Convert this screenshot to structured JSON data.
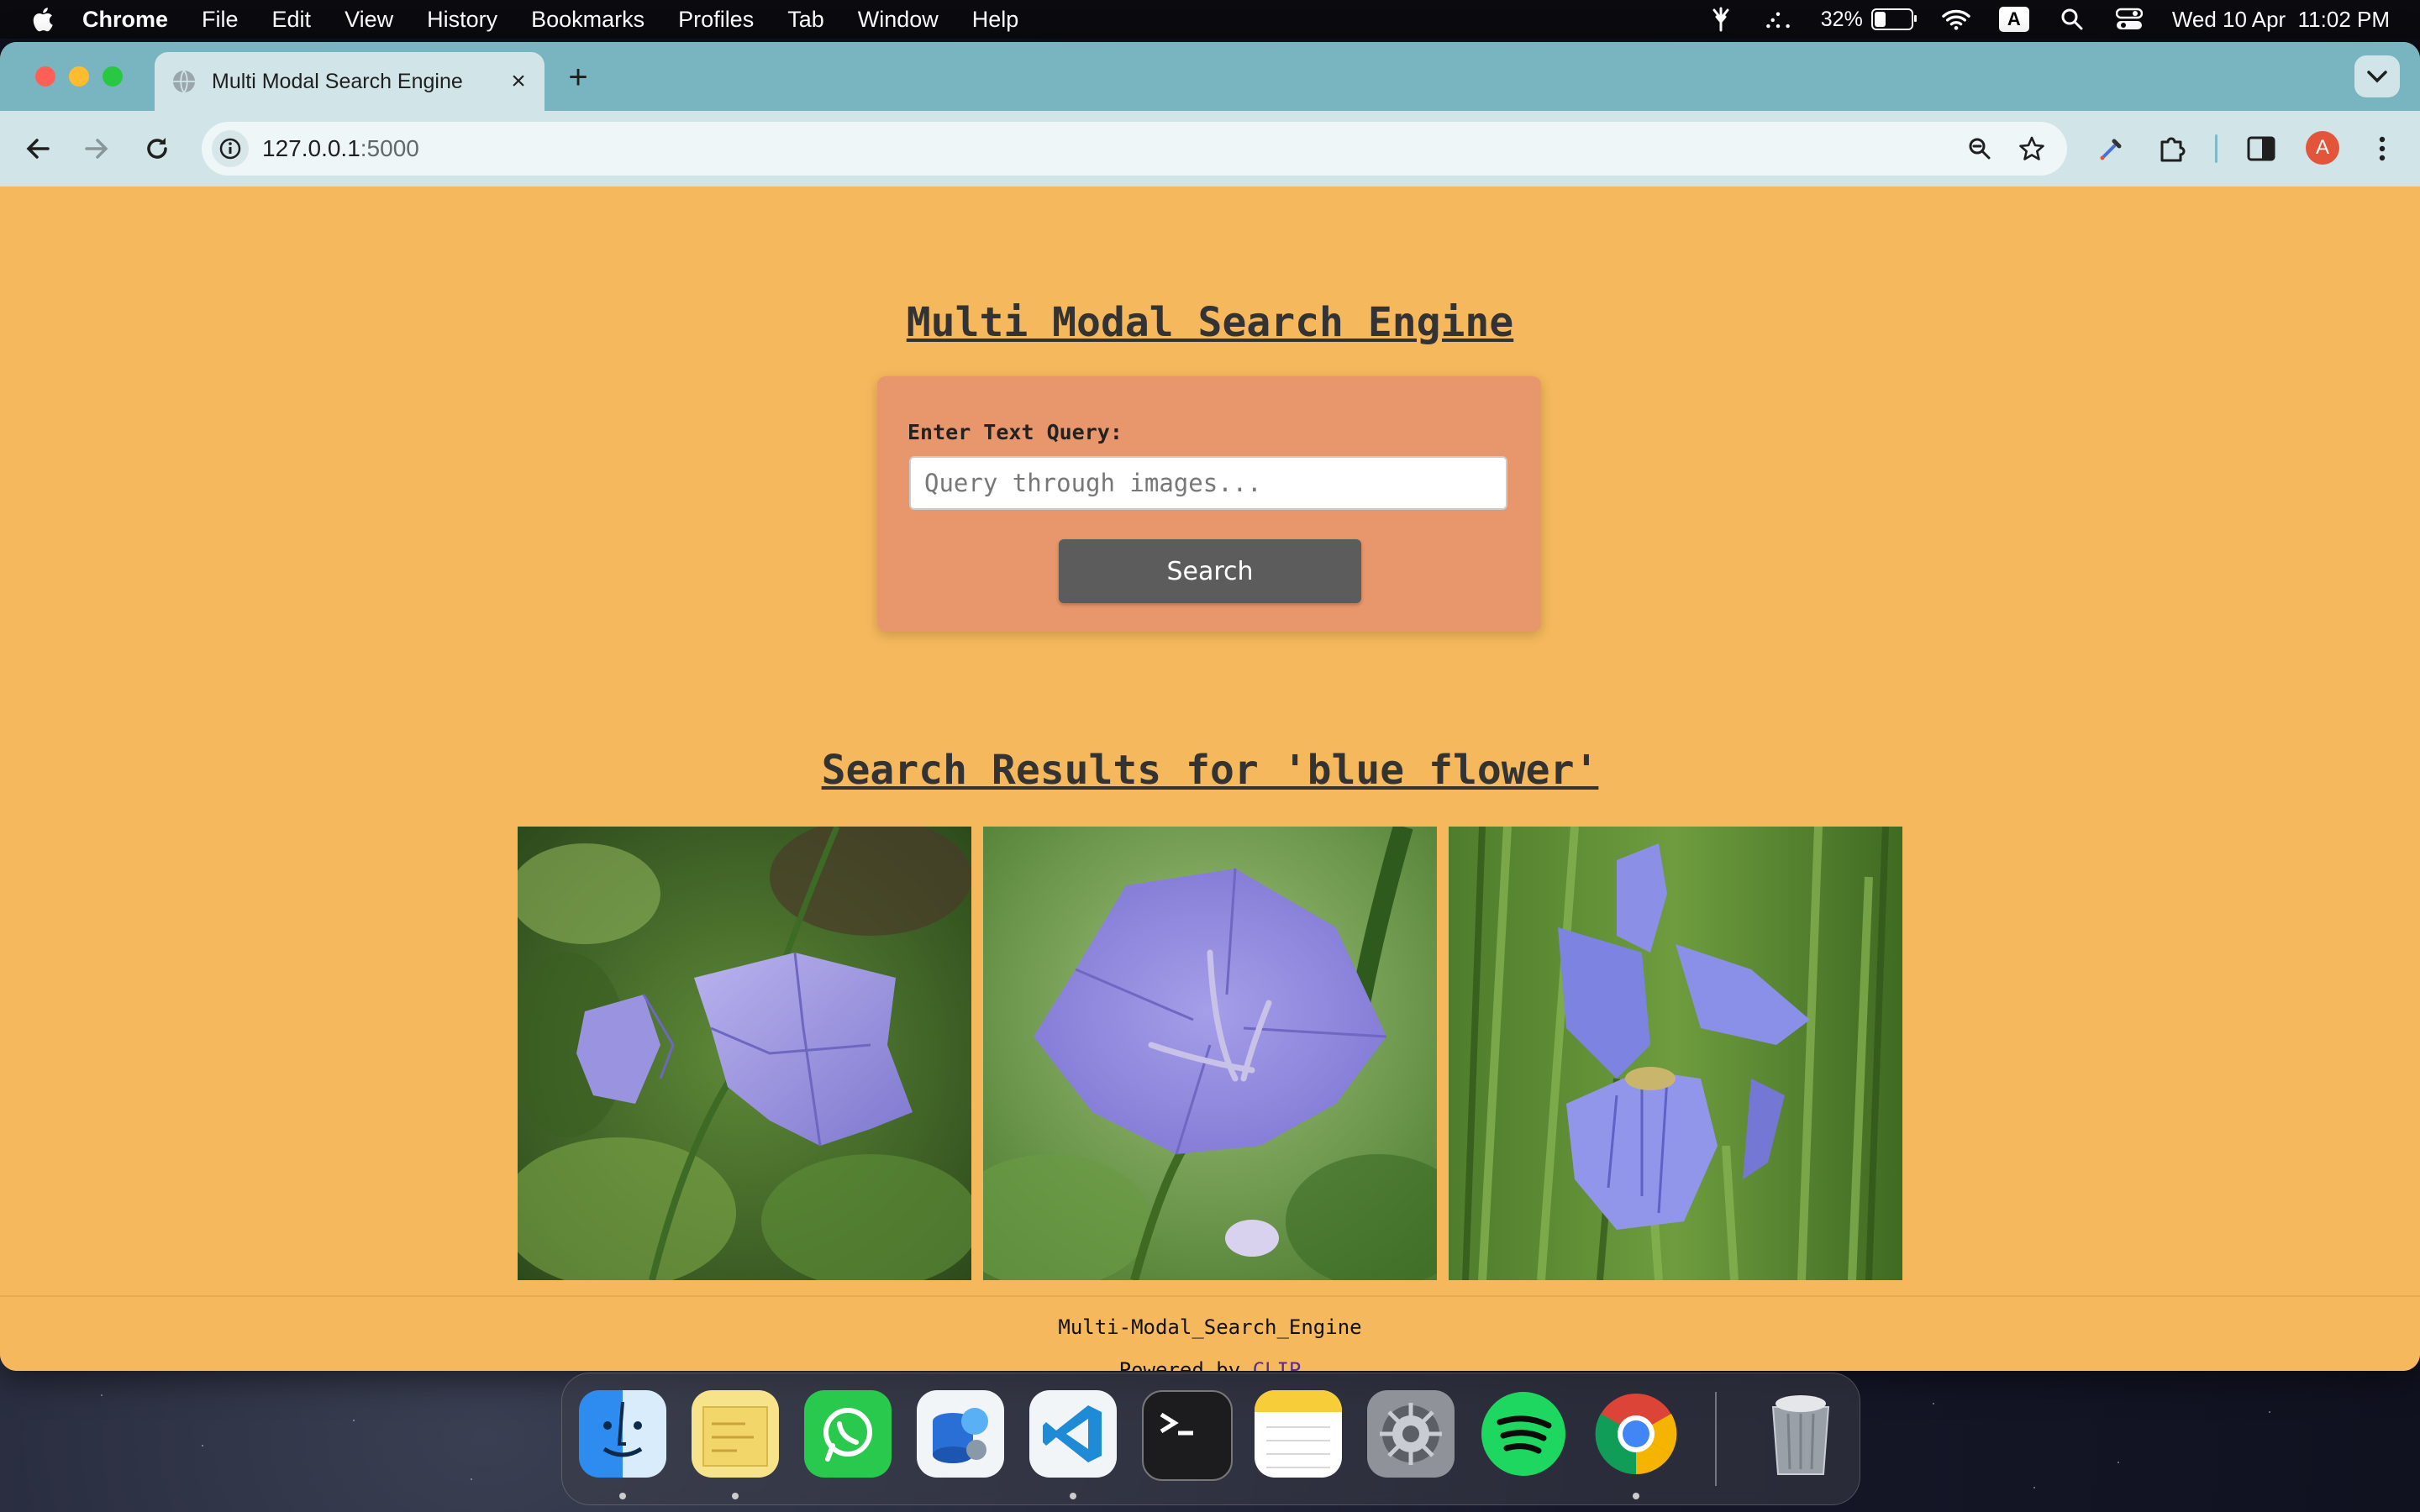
{
  "menubar": {
    "app_name": "Chrome",
    "items": [
      "File",
      "Edit",
      "View",
      "History",
      "Bookmarks",
      "Profiles",
      "Tab",
      "Window",
      "Help"
    ],
    "battery_percent": "32%",
    "battery_level": 0.32,
    "input_indicator": "A",
    "datetime": "Wed 10 Apr  11:02 PM"
  },
  "browser": {
    "tab_title": "Multi Modal Search Engine",
    "url_host": "127.0.0.1",
    "url_port": ":5000",
    "profile_initial": "A"
  },
  "page": {
    "title": "Multi Modal Search Engine",
    "query_label": "Enter Text Query:",
    "query_placeholder": "Query through images...",
    "search_button": "Search",
    "results_title": "Search Results for 'blue flower'",
    "footer_name": "Multi-Modal_Search_Engine",
    "footer_powered_prefix": "Powered by ",
    "footer_link": "CLIP"
  },
  "colors": {
    "page_bg": "#f5b85c",
    "card_bg": "#e8976c",
    "button_bg": "#5c5c5c",
    "tabstrip_bg": "#79b5c0",
    "toolbar_bg": "#d1e5e8",
    "link": "#5a2d91"
  },
  "dock": {
    "apps": [
      "finder",
      "notes-stickies",
      "whatsapp",
      "disk-utility",
      "vscode",
      "terminal",
      "notes",
      "system-settings",
      "spotify",
      "chrome",
      "trash"
    ]
  }
}
